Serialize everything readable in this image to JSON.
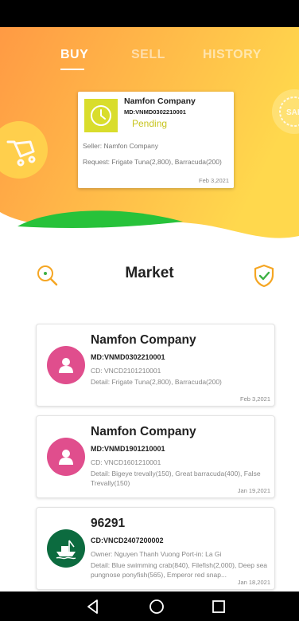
{
  "tabs": [
    {
      "label": "BUY",
      "active": true
    },
    {
      "label": "SELL",
      "active": false
    },
    {
      "label": "HISTORY",
      "active": false
    }
  ],
  "pending_card": {
    "company": "Namfon Company",
    "md": "MD:VNMD0302210001",
    "status": "Pending",
    "seller": "Seller: Namfon Company",
    "request": "Request: Frigate Tuna(2,800), Barracuda(200)",
    "date": "Feb 3,2021"
  },
  "market": {
    "title": "Market"
  },
  "listings": [
    {
      "title": "Namfon Company",
      "code": "MD:VNMD0302210001",
      "line": "CD: VNCD2101210001",
      "detail": "Detail: Frigate Tuna(2,800), Barracuda(200)",
      "date": "Feb 3,2021"
    },
    {
      "title": "Namfon Company",
      "code": "MD:VNMD1901210001",
      "line": "CD: VNCD1601210001",
      "detail": "Detail: Bigeye trevally(150), Great barracuda(400), False Trevally(150)",
      "date": "Jan 19,2021"
    },
    {
      "title": "96291",
      "code": "CD:VNCD2407200002",
      "line": "Owner: Nguyen Thanh Vuong  Port-in: La Gi",
      "detail": "Detail: Blue swimming crab(840), Filefish(2,000), Deep sea pungnose ponyfish(565), Emperor red snap...",
      "date": "Jan 18,2021"
    }
  ],
  "colors": {
    "hero_gradient_start": "#ff9a44",
    "hero_gradient_end": "#ffd84d",
    "pending": "#c7c41e",
    "avatar_pink": "#e04e8d",
    "avatar_green": "#0c6b3f",
    "wave_green": "#27c23a"
  },
  "icons": [
    "clock-icon",
    "shopping-cart-icon",
    "sale-tag-icon",
    "search-icon",
    "shield-check-icon",
    "person-icon",
    "fishing-boat-icon",
    "back-icon",
    "home-icon",
    "recents-icon"
  ]
}
